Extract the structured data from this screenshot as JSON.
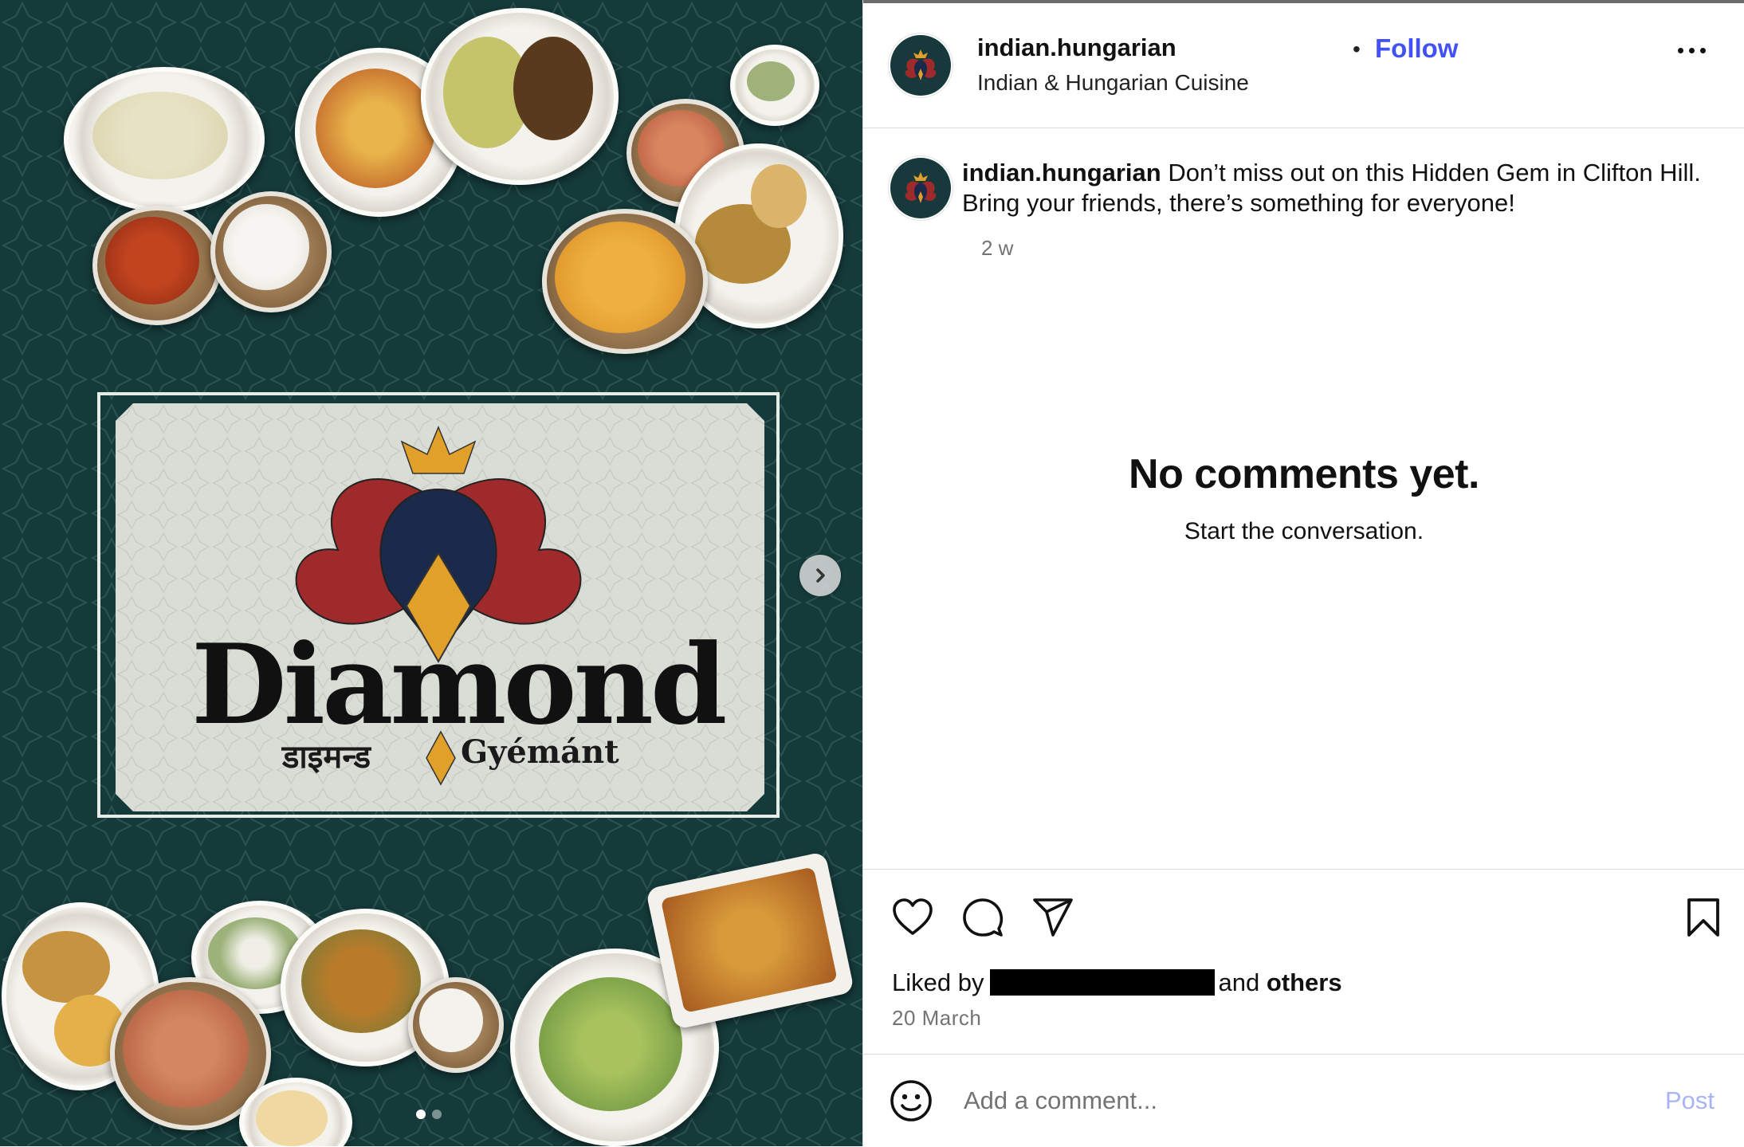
{
  "post": {
    "username": "indian.hungarian",
    "subtitle": "Indian & Hungarian Cuisine",
    "follow_separator": "•",
    "follow_label": "Follow",
    "more_icon": "more-horizontal-icon",
    "caption_text": "Don’t miss out on this Hidden Gem in Clifton Hill. Bring your friends, there’s something for everyone!",
    "time_ago": "2 w"
  },
  "comments": {
    "empty_title": "No comments yet.",
    "empty_subtitle": "Start the conversation."
  },
  "actions": {
    "like_icon": "heart-icon",
    "comment_icon": "comment-bubble-icon",
    "share_icon": "paper-plane-icon",
    "save_icon": "bookmark-icon",
    "liked_prefix": "Liked by",
    "liked_middle": "and",
    "liked_suffix": "others",
    "date": "20 March"
  },
  "composer": {
    "emoji_icon": "emoji-smile-icon",
    "placeholder": "Add a comment...",
    "post_label": "Post"
  },
  "media": {
    "logo_text": "Diamond",
    "logo_subtitle_hindi": "डाइमन्ड",
    "logo_subtitle_hungarian": "Gyémánt",
    "carousel_total": 2,
    "carousel_active": 1,
    "next_icon": "chevron-right-icon"
  },
  "colors": {
    "media_background": "#153a3a",
    "logo_red": "#9e2a2b",
    "logo_navy": "#1b2a4a",
    "logo_gold": "#e0a02a",
    "follow_blue": "#4150f7",
    "post_disabled": "#a8b4f7"
  }
}
